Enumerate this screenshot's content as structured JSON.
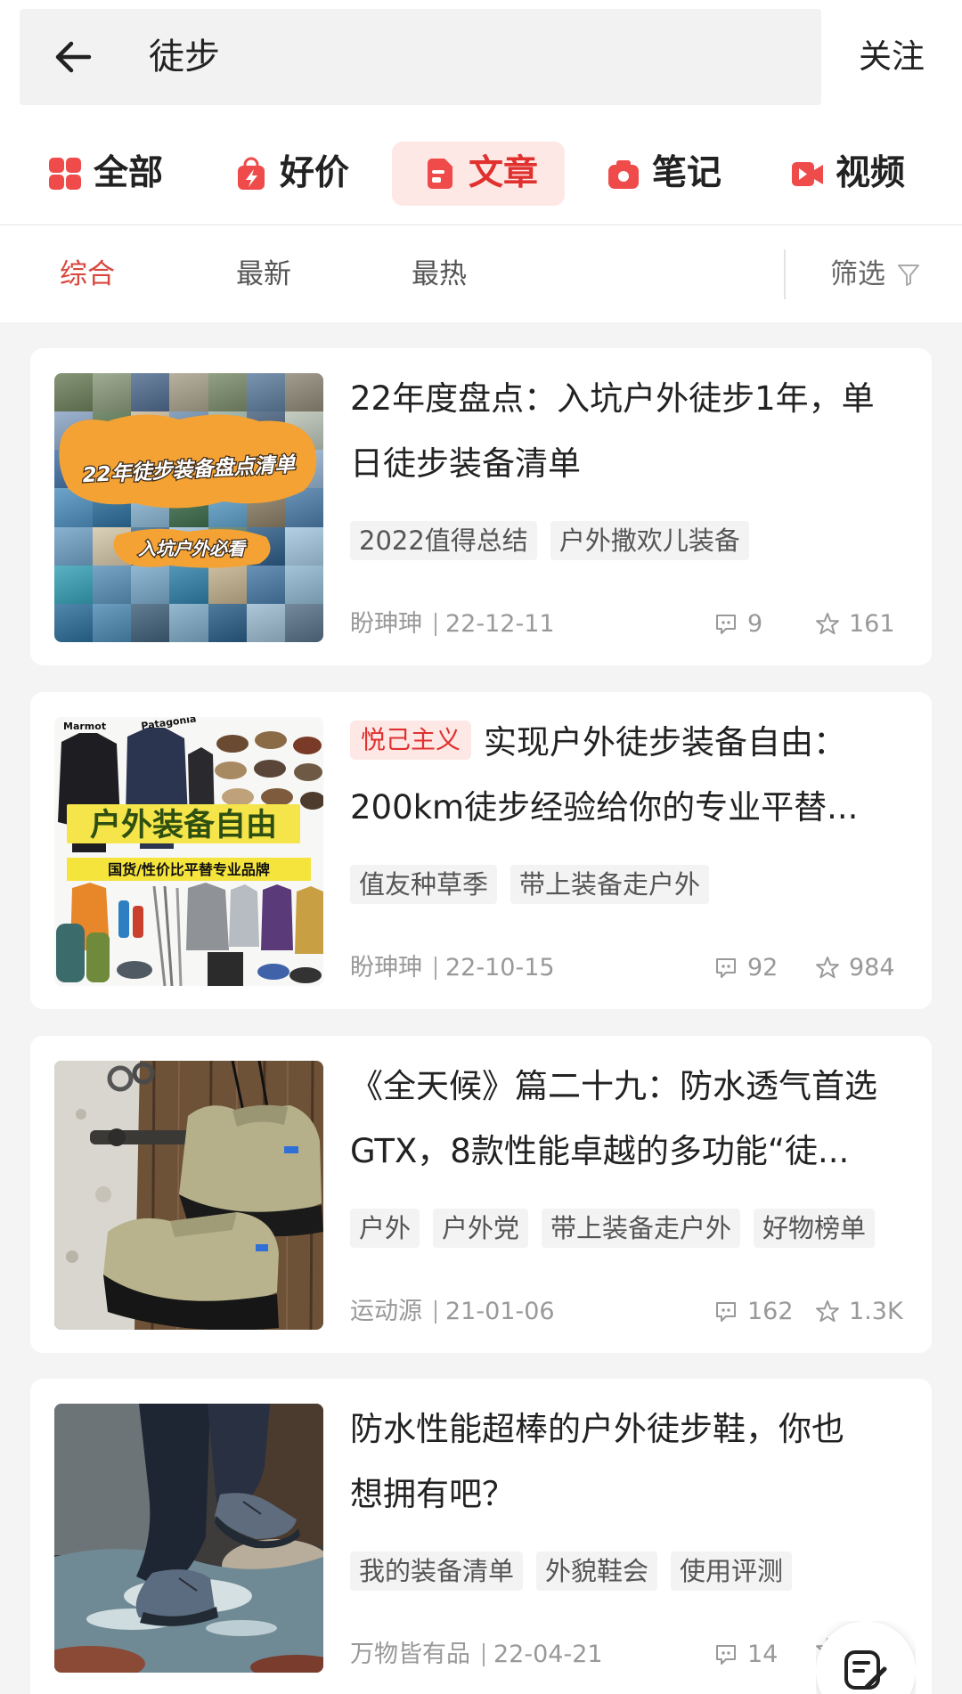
{
  "search": {
    "query": "徒步",
    "follow_label": "关注",
    "back_icon": "arrow-left-icon"
  },
  "categories": [
    {
      "label": "全部",
      "icon": "grid-icon",
      "active": false
    },
    {
      "label": "好价",
      "icon": "deal-bag-icon",
      "active": false
    },
    {
      "label": "文章",
      "icon": "article-icon",
      "active": true
    },
    {
      "label": "笔记",
      "icon": "note-camera-icon",
      "active": false
    },
    {
      "label": "视频",
      "icon": "video-icon",
      "active": false
    }
  ],
  "sort": {
    "tabs": [
      "综合",
      "最新",
      "最热"
    ],
    "active_index": 0,
    "filter_label": "筛选",
    "filter_icon": "funnel-icon"
  },
  "meta_icons": {
    "comments": "comment-icon",
    "favorites": "star-icon"
  },
  "colors": {
    "accent": "#e0312f",
    "accent_bg": "#fde8e6",
    "text": "#222222",
    "muted": "#999999",
    "page_bg": "#f4f4f4",
    "tag_bg": "#f3f3f3"
  },
  "articles": [
    {
      "title_lines": [
        "22年度盘点：入坑户外徒步1年，单",
        "日徒步装备清单"
      ],
      "tags": [
        "2022值得总结",
        "户外撒欢儿装备"
      ],
      "author": "盼珅珅",
      "date": "22-12-11",
      "comments": "9",
      "favorites": "161",
      "thumbnail_text": [
        "22年徒步装备盘点清单",
        "入坑户外必看"
      ]
    },
    {
      "badge": "悦己主义",
      "title_lines": [
        "实现户外徒步装备自由：",
        "200km徒步经验给你的专业平替..."
      ],
      "tags": [
        "值友种草季",
        "带上装备走户外"
      ],
      "author": "盼珅珅",
      "date": "22-10-15",
      "comments": "92",
      "favorites": "984",
      "thumbnail_text": [
        "户外装备自由",
        "国货/性价比平替专业品牌",
        "Marmot",
        "Patagonia"
      ]
    },
    {
      "title_lines": [
        "《全天候》篇二十九：防水透气首选",
        "GTX，8款性能卓越的多功能“徒..."
      ],
      "tags": [
        "户外",
        "户外党",
        "带上装备走户外",
        "好物榜单"
      ],
      "author": "运动源",
      "date": "21-01-06",
      "comments": "162",
      "favorites": "1.3K"
    },
    {
      "title_lines": [
        "防水性能超棒的户外徒步鞋，你也",
        "想拥有吧？"
      ],
      "tags": [
        "我的装备清单",
        "外貌鞋会",
        "使用评测"
      ],
      "author": "万物皆有品",
      "date": "22-04-21",
      "comments": "14"
    }
  ],
  "fab": {
    "icon": "write-post-icon"
  }
}
